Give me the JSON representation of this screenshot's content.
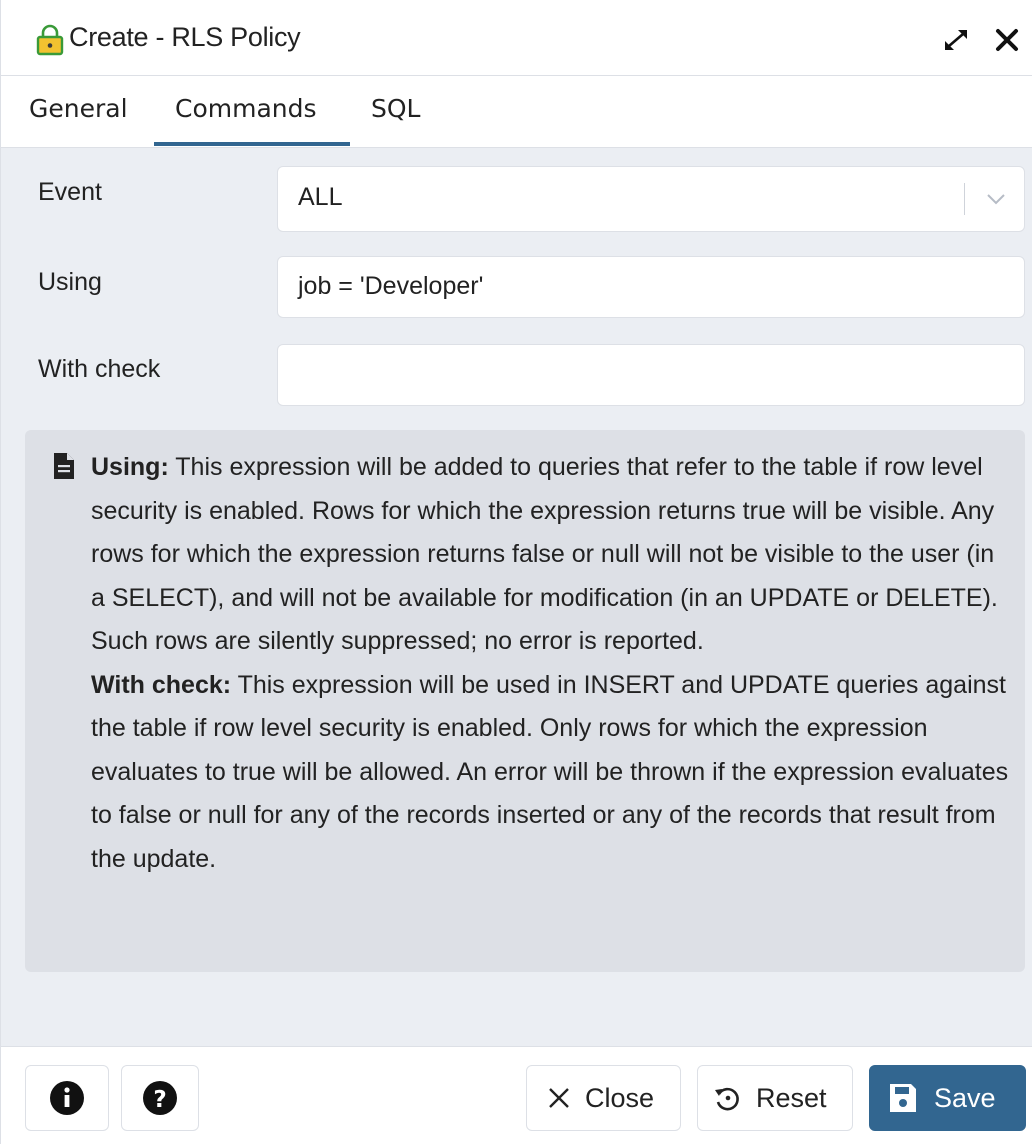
{
  "dialog": {
    "title": "Create - RLS Policy",
    "icons": {
      "title": "lock-icon",
      "maximize": "expand-icon",
      "close": "close-icon"
    }
  },
  "tabs": [
    {
      "label": "General",
      "active": false
    },
    {
      "label": "Commands",
      "active": true
    },
    {
      "label": "SQL",
      "active": false
    }
  ],
  "form": {
    "event": {
      "label": "Event",
      "value": "ALL"
    },
    "using": {
      "label": "Using",
      "value": "job = 'Developer'"
    },
    "with_check": {
      "label": "With check",
      "value": ""
    }
  },
  "help": {
    "icon": "document-icon",
    "using_heading": "Using:",
    "using_text": " This expression will be added to queries that refer to the table if row level security is enabled. Rows for which the expression returns true will be visible. Any rows for which the expression returns false or null will not be visible to the user (in a SELECT), and will not be available for modification (in an UPDATE or DELETE). Such rows are silently suppressed; no error is reported.",
    "with_check_heading": "With check:",
    "with_check_text": " This expression will be used in INSERT and UPDATE queries against the table if row level security is enabled. Only rows for which the expression evaluates to true will be allowed. An error will be thrown if the expression evaluates to false or null for any of the records inserted or any of the records that result from the update."
  },
  "footer": {
    "info_icon": "info-icon",
    "help_icon": "question-icon",
    "close_label": "Close",
    "reset_label": "Reset",
    "save_label": "Save"
  },
  "colors": {
    "accent": "#326690",
    "panel_bg": "#ebeef3",
    "help_bg": "#dde0e6"
  }
}
